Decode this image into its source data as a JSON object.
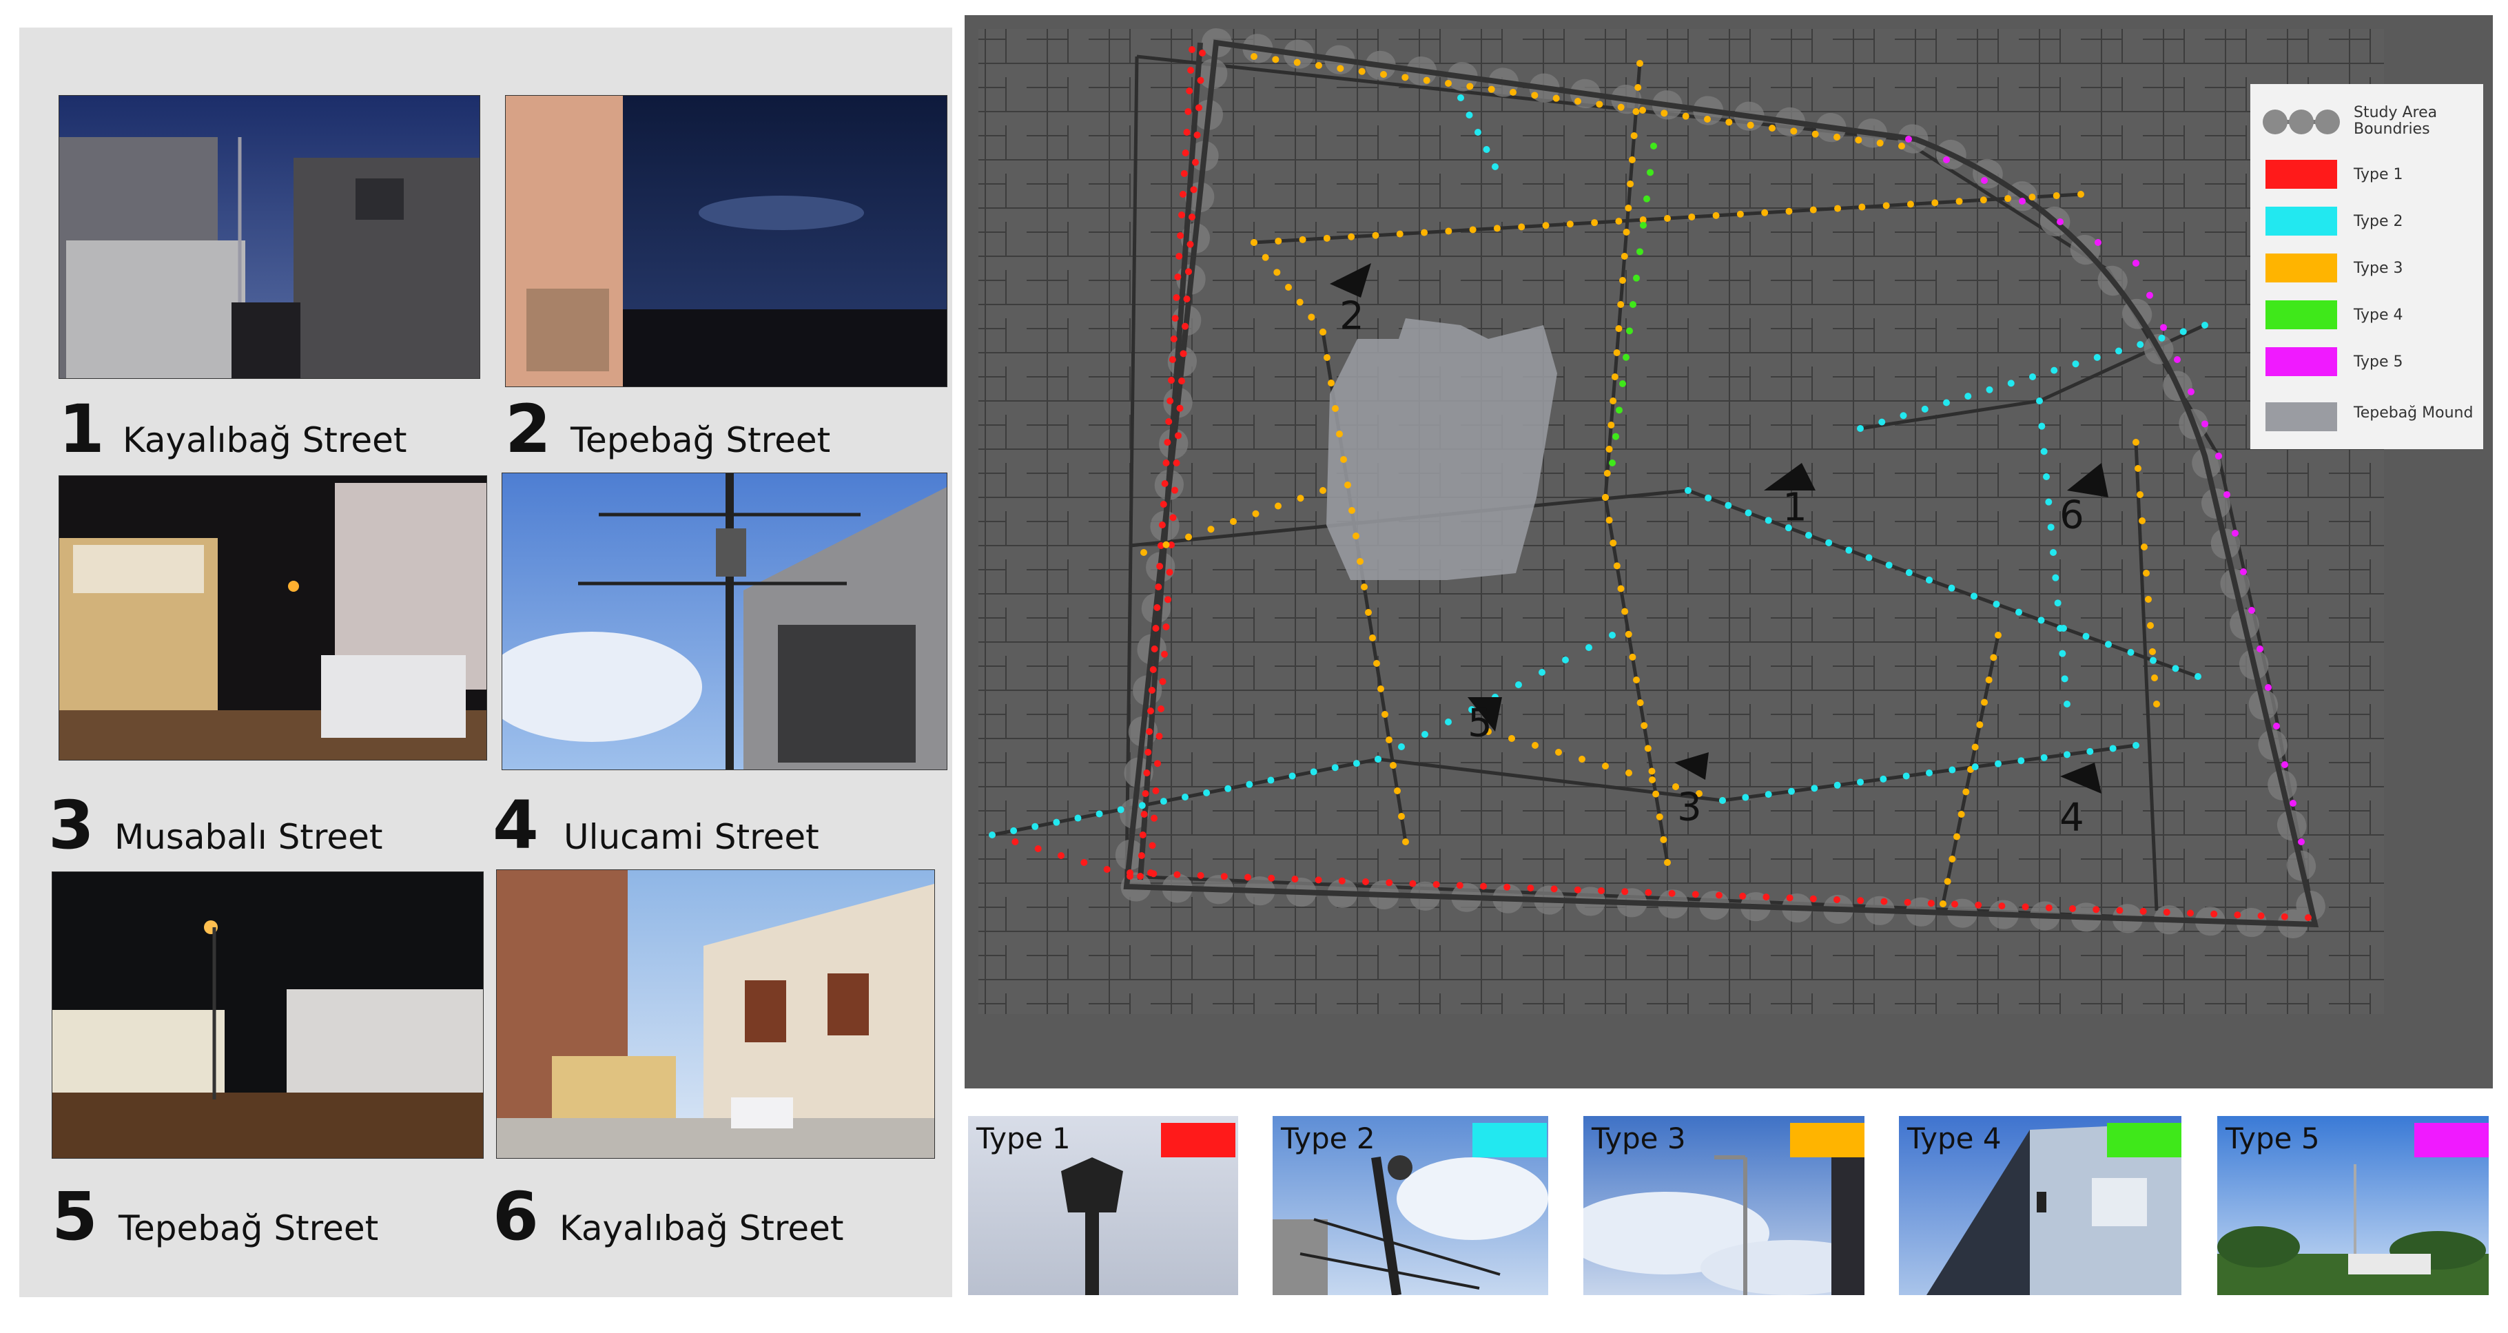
{
  "photos": [
    {
      "num": "1",
      "street": "Kayalıbağ Street"
    },
    {
      "num": "2",
      "street": "Tepebağ Street"
    },
    {
      "num": "3",
      "street": "Musabalı Street"
    },
    {
      "num": "4",
      "street": "Ulucami Street"
    },
    {
      "num": "5",
      "street": "Tepebağ Street"
    },
    {
      "num": "6",
      "street": "Kayalıbağ Street"
    }
  ],
  "legend": {
    "boundary": "Study Area Boundries",
    "mound": "Tepebağ Mound",
    "types": [
      {
        "label": "Type 1",
        "color": "#ff1a1a"
      },
      {
        "label": "Type 2",
        "color": "#22e8f0"
      },
      {
        "label": "Type 3",
        "color": "#ffb400"
      },
      {
        "label": "Type 4",
        "color": "#3fe81a"
      },
      {
        "label": "Type 5",
        "color": "#f01aff"
      }
    ]
  },
  "map_viewpoints": [
    "1",
    "2",
    "3",
    "4",
    "5",
    "6"
  ],
  "type_cards": [
    {
      "label": "Type 1",
      "color": "#ff1a1a"
    },
    {
      "label": "Type 2",
      "color": "#22e8f0"
    },
    {
      "label": "Type 3",
      "color": "#ffb400"
    },
    {
      "label": "Type 4",
      "color": "#3fe81a"
    },
    {
      "label": "Type 5",
      "color": "#f01aff"
    }
  ]
}
